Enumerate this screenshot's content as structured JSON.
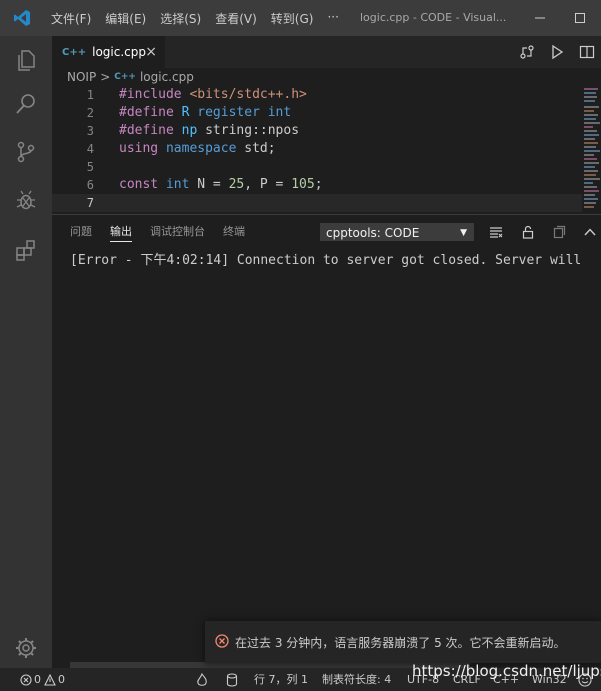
{
  "titlebar": {
    "menu": [
      "文件(F)",
      "编辑(E)",
      "选择(S)",
      "查看(V)",
      "转到(G)",
      "···"
    ],
    "title": "logic.cpp - CODE - Visual..."
  },
  "tabs": [
    {
      "icon": "C++",
      "label": "logic.cpp",
      "close": "×"
    }
  ],
  "breadcrumb": {
    "folder": "NOIP",
    "separator": ">",
    "file_icon": "C++",
    "file": "logic.cpp"
  },
  "code": {
    "lines": [
      {
        "n": "1",
        "tokens": [
          {
            "t": "#include ",
            "c": "#c586c0"
          },
          {
            "t": "<bits/stdc++.h>",
            "c": "#ce9178"
          }
        ]
      },
      {
        "n": "2",
        "tokens": [
          {
            "t": "#define ",
            "c": "#c586c0"
          },
          {
            "t": "R ",
            "c": "#4fc1ff"
          },
          {
            "t": "register ",
            "c": "#569cd6"
          },
          {
            "t": "int",
            "c": "#569cd6"
          }
        ]
      },
      {
        "n": "3",
        "tokens": [
          {
            "t": "#define ",
            "c": "#c586c0"
          },
          {
            "t": "np ",
            "c": "#4fc1ff"
          },
          {
            "t": "string::npos",
            "c": "#cccccc"
          }
        ]
      },
      {
        "n": "4",
        "tokens": [
          {
            "t": "using ",
            "c": "#c586c0"
          },
          {
            "t": "namespace ",
            "c": "#569cd6"
          },
          {
            "t": "std;",
            "c": "#cccccc"
          }
        ]
      },
      {
        "n": "5",
        "tokens": []
      },
      {
        "n": "6",
        "tokens": [
          {
            "t": "const ",
            "c": "#c586c0"
          },
          {
            "t": "int ",
            "c": "#569cd6"
          },
          {
            "t": "N = ",
            "c": "#cccccc"
          },
          {
            "t": "25",
            "c": "#b5cea8"
          },
          {
            "t": ", P = ",
            "c": "#cccccc"
          },
          {
            "t": "105",
            "c": "#b5cea8"
          },
          {
            "t": ";",
            "c": "#cccccc"
          }
        ]
      },
      {
        "n": "7",
        "tokens": []
      }
    ],
    "current_line": "7"
  },
  "panel": {
    "tabs": [
      "问题",
      "输出",
      "调试控制台",
      "终端"
    ],
    "active_tab": "输出",
    "channel": "cpptools: CODE",
    "output": "[Error - 下午4:02:14] Connection to server got closed. Server will"
  },
  "toast": {
    "message": "在过去 3 分钟内，语言服务器崩溃了 5 次。它不会重新启动。"
  },
  "statusbar": {
    "errors": "0",
    "warnings": "0",
    "position": "行 7，列 1",
    "tab_size": "制表符长度: 4",
    "encoding": "UTF-8",
    "eol": "CRLF",
    "language": "C++",
    "platform": "Win32"
  },
  "watermark": "https://blog.csdn.net/ljups",
  "colors": {
    "accent": "#007acc",
    "error": "#f48771",
    "activity_icon": "#858585"
  }
}
